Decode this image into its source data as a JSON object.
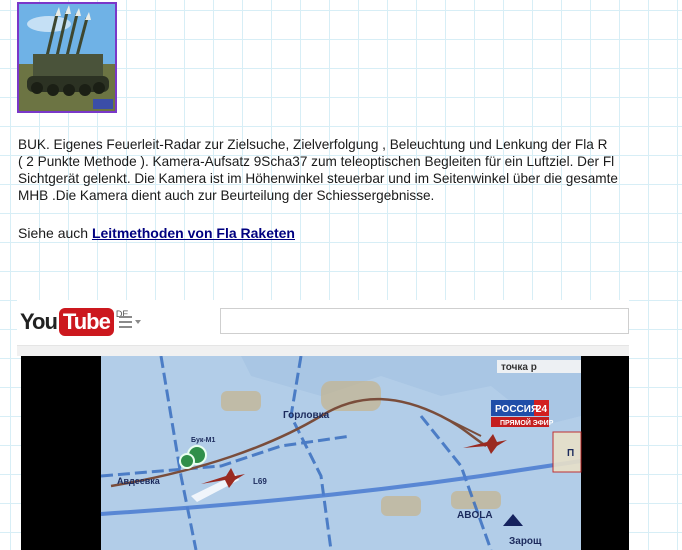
{
  "article": {
    "lines": [
      "BUK. Eigenes Feuerleit-Radar zur Zielsuche, Zielverfolgung , Beleuchtung und Lenkung der Fla R",
      "( 2 Punkte Methode ). Kamera-Aufsatz  9Scha37   zum teleoptischen Begleiten für ein Luftziel. Der Fl",
      "Sichtgerät gelenkt. Die  Kamera ist im Höhenwinkel steuerbar und im Seitenwinkel über die gesamte",
      "MHB .Die Kamera dient auch zur Beurteilung der Schiessergebnisse."
    ],
    "see_also_prefix": "Siehe auch ",
    "see_also_link": "Leitmethoden von Fla Raketen"
  },
  "youtube": {
    "logo_you": "You",
    "logo_tube": "Tube",
    "region": "DE",
    "search_value": ""
  },
  "video_map": {
    "labels": {
      "tochka": "точка р",
      "gorlovka": "Горловка",
      "avdeevka": "Авдеевка",
      "road": "L69",
      "buk1": "Бук-М1",
      "abola": "ABOLA",
      "zarosh": "Зарощ",
      "right_edge": "П"
    },
    "channel_badge": {
      "name": "РОССИЯ",
      "number": "24",
      "live": "ПРЯМОЙ ЭФИР"
    }
  },
  "colors": {
    "link": "#000080",
    "yt_red": "#cc181e",
    "thumb_border": "#7a37c9",
    "grid": "#d7eef6"
  }
}
